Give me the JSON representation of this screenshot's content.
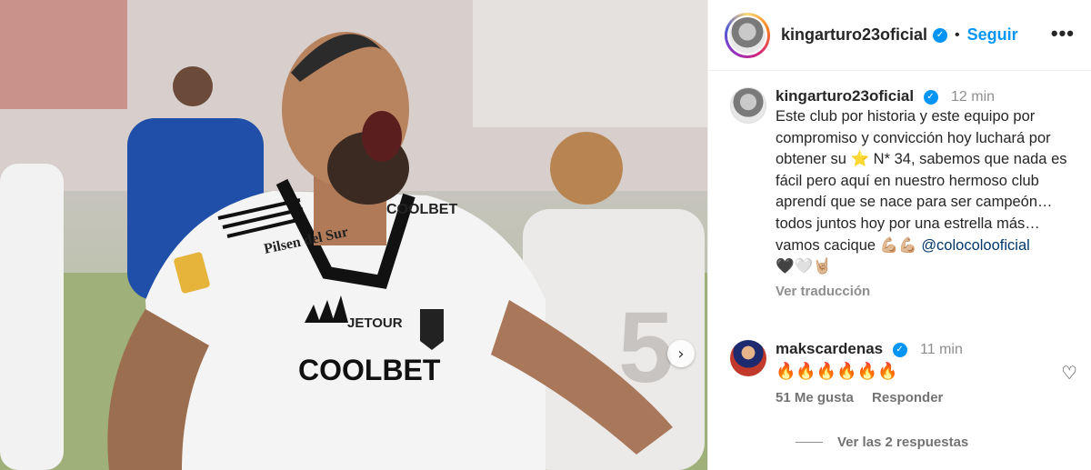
{
  "post": {
    "username": "kingarturo23oficial",
    "follow_label": "Seguir",
    "more_label": "•••",
    "next_icon": "chevron-right-icon",
    "jersey": {
      "sponsor_top": "Pilsen del Sur",
      "brand": "JETOUR",
      "sponsor_main": "COOLBET",
      "sleeve": "COOLBET"
    }
  },
  "caption": {
    "username": "kingarturo23oficial",
    "time": "12 min",
    "text_before": "Este club por historia y este equipo por compromiso y convicción hoy luchará por obtener su ⭐ N* 34, sabemos que nada es fácil pero aquí en nuestro hermoso club aprendí que se nace para ser campeón… todos juntos hoy por una estrella más… vamos cacique 💪🏼💪🏼 ",
    "mention": "@colocolooficial",
    "text_after": "🖤🤍🤘🏼",
    "translate_label": "Ver traducción"
  },
  "comment": {
    "username": "makscardenas",
    "time": "11 min",
    "text": "🔥🔥🔥🔥🔥🔥",
    "likes_label": "51 Me gusta",
    "reply_label": "Responder"
  },
  "replies_label": "Ver las 2 respuestas",
  "colors": {
    "accent": "#0095f6",
    "mention": "#00376b",
    "muted": "#8e8e8e"
  }
}
